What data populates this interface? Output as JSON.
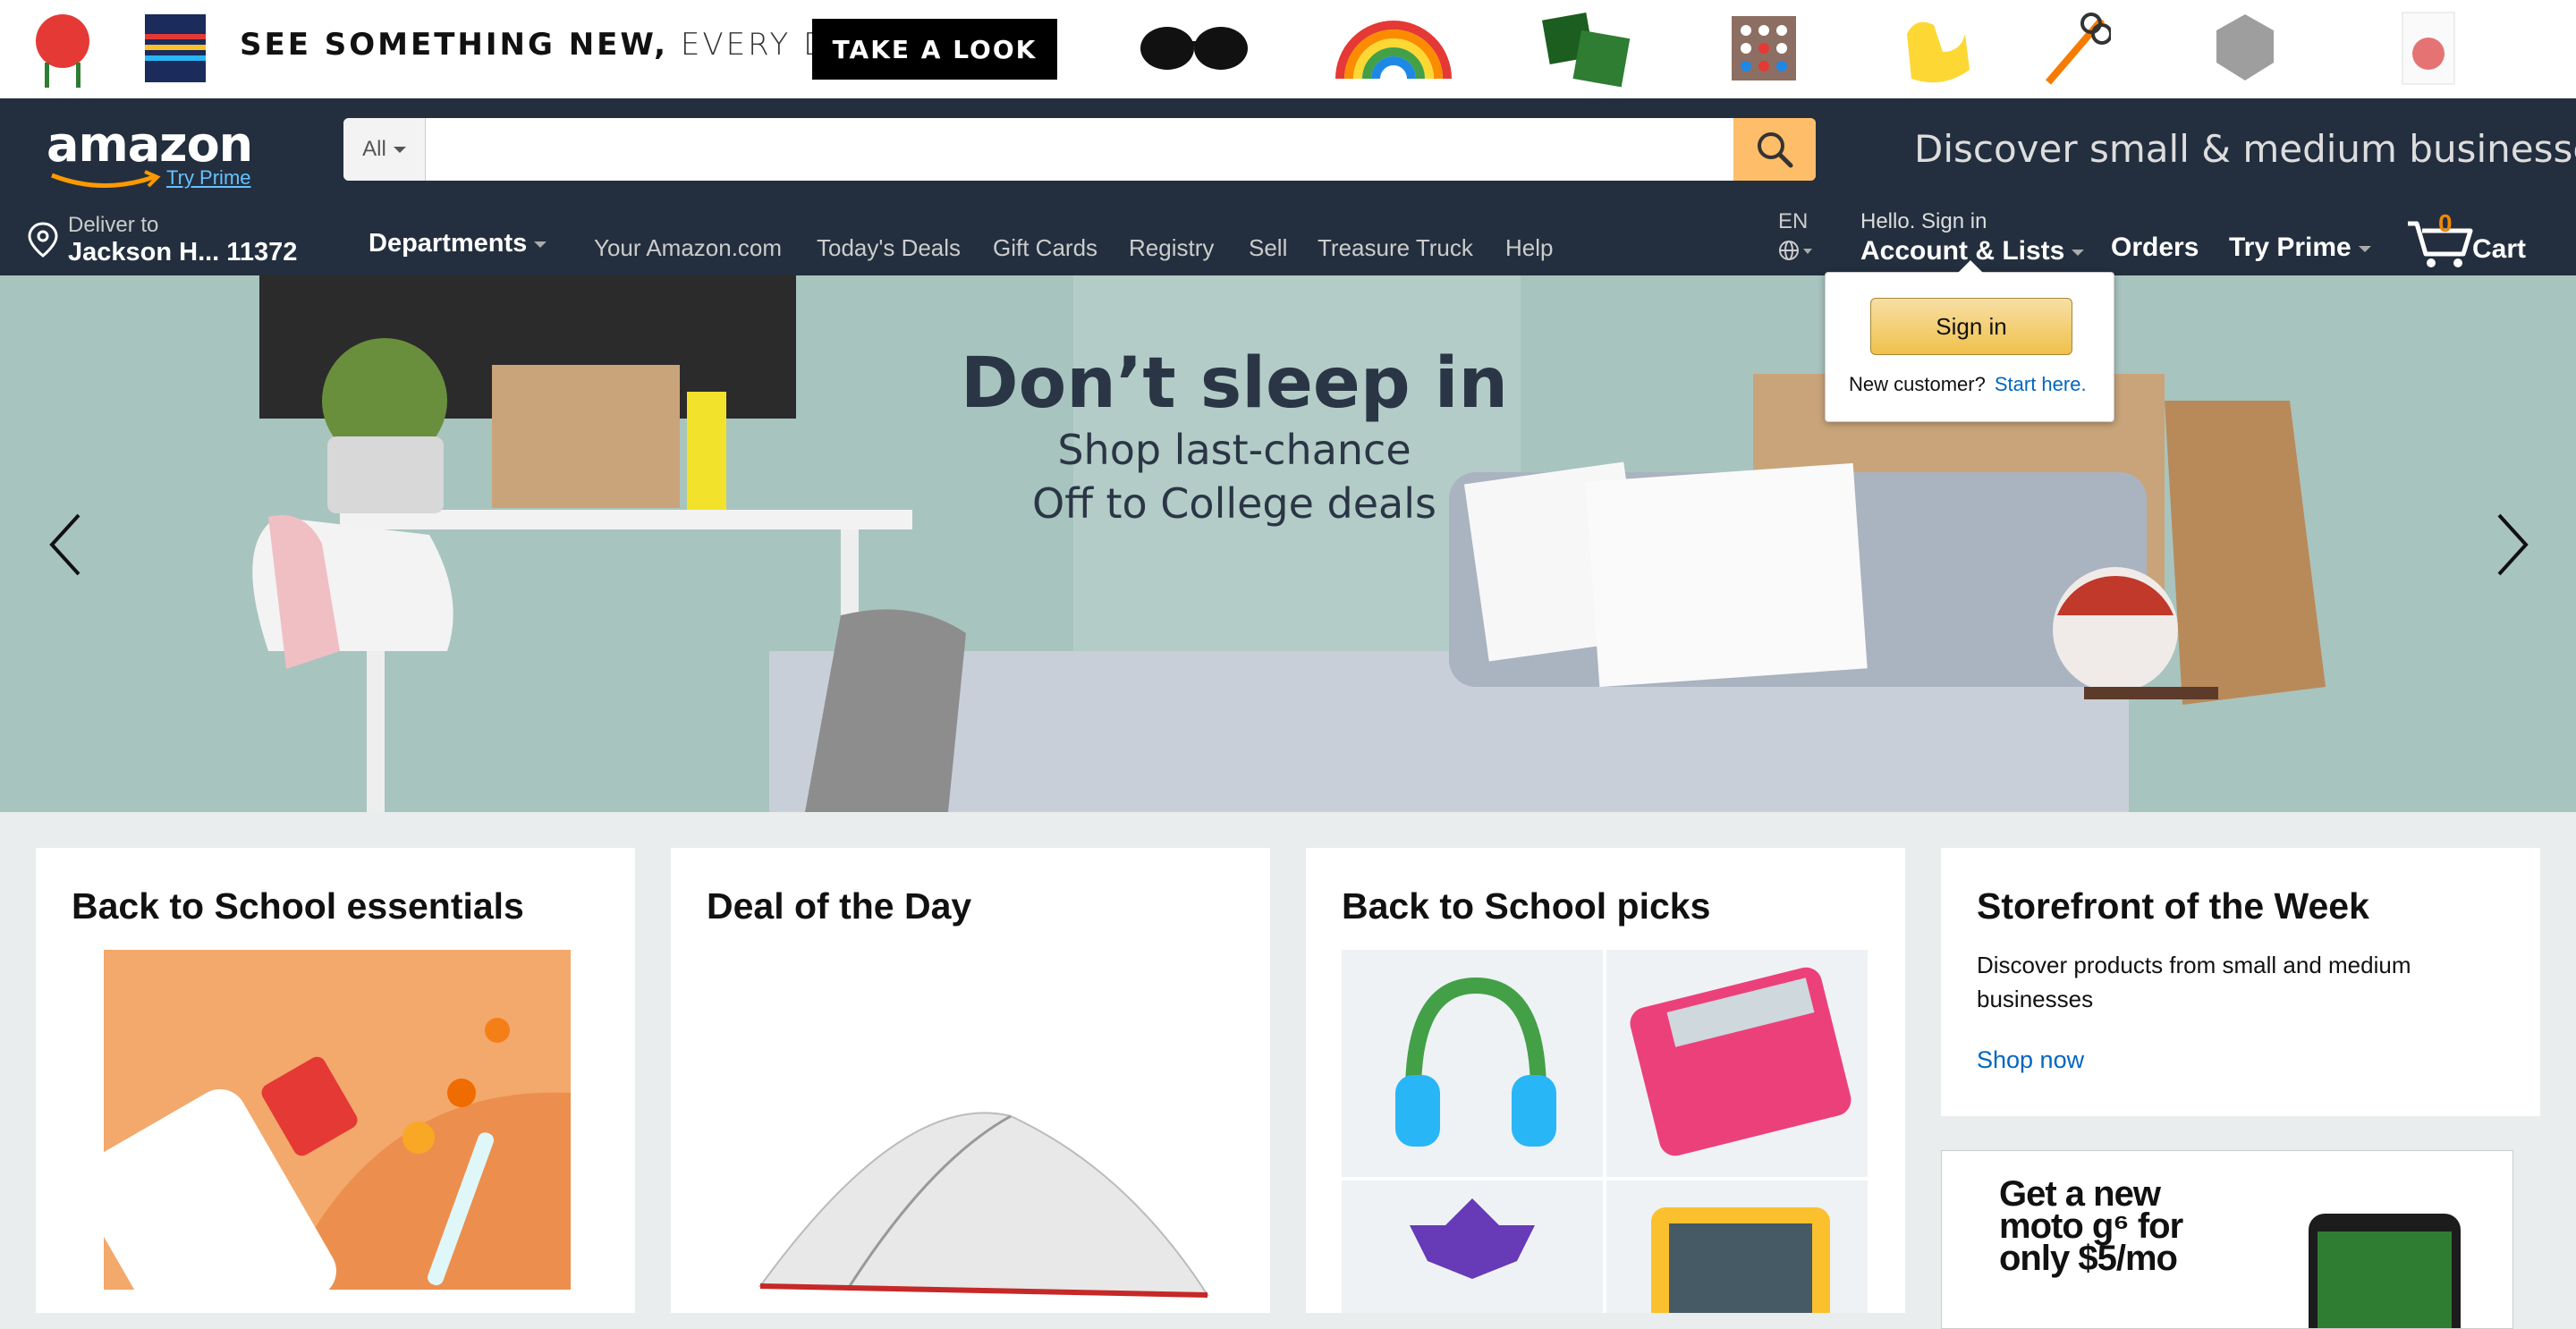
{
  "promo": {
    "text_bold": "SEE SOMETHING NEW,",
    "text_light": "EVERY DAY.",
    "button": "TAKE A LOOK"
  },
  "header": {
    "logo": "amazon",
    "try_prime_link": "Try Prime",
    "search": {
      "category": "All",
      "placeholder": ""
    },
    "discover": "Discover small & medium businesses",
    "deliver": {
      "line1": "Deliver to",
      "line2": "Jackson H... 11372"
    },
    "departments": "Departments",
    "nav_links": [
      "Your Amazon.com",
      "Today's Deals",
      "Gift Cards",
      "Registry",
      "Sell",
      "Treasure Truck",
      "Help"
    ],
    "lang": "EN",
    "account": {
      "hello": "Hello. Sign in",
      "label": "Account & Lists"
    },
    "orders": "Orders",
    "try_prime": "Try Prime",
    "cart": {
      "count": "0",
      "label": "Cart"
    }
  },
  "signin_popover": {
    "button": "Sign in",
    "new_customer": "New customer?",
    "start_here": "Start here."
  },
  "hero": {
    "title": "Don’t sleep in",
    "sub1": "Shop last-chance",
    "sub2": "Off to College deals"
  },
  "cards": [
    {
      "title": "Back to School essentials"
    },
    {
      "title": "Deal of the Day"
    },
    {
      "title": "Back to School picks"
    },
    {
      "title": "Storefront of the Week",
      "text": "Discover products from small and medium businesses",
      "link": "Shop now"
    }
  ],
  "ad": {
    "text": "Get a new moto g⁶ for only $5/mo"
  },
  "colors": {
    "nav_dark": "#232f3e",
    "search_btn": "#febd69",
    "cart_count": "#f08804",
    "link": "#0066c0",
    "prime_link": "#67c1ff"
  }
}
